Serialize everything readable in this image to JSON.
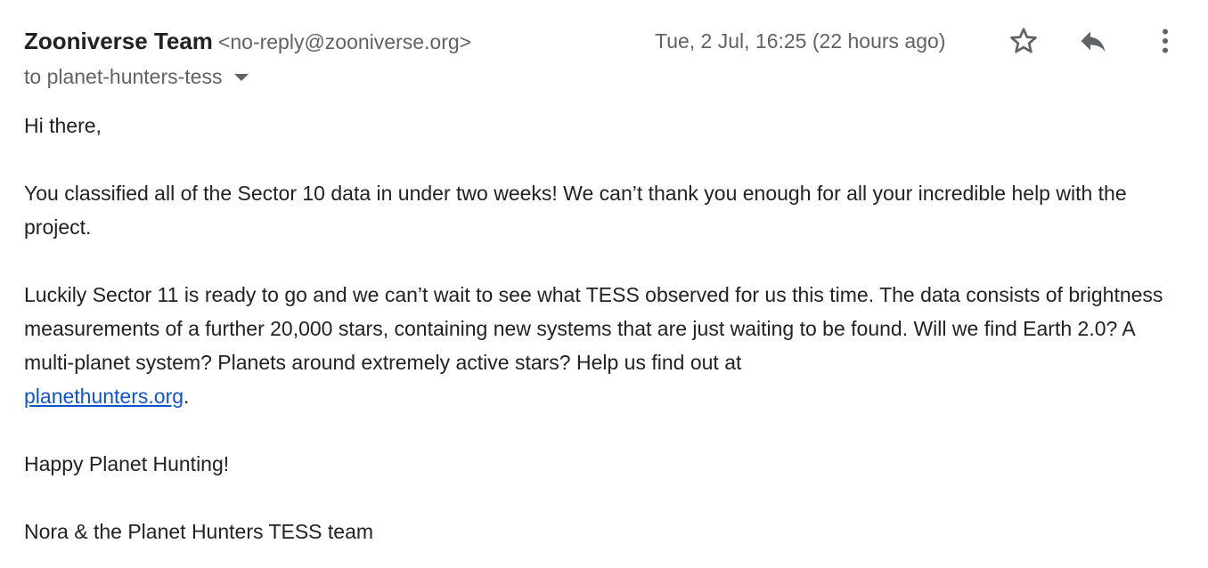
{
  "email": {
    "sender_name": "Zooniverse Team",
    "sender_email": "<no-reply@zooniverse.org>",
    "recipient": "to planet-hunters-tess",
    "timestamp": "Tue, 2 Jul, 16:25 (22 hours ago)",
    "icons": {
      "star": "star-outline-icon",
      "reply": "reply-icon",
      "more": "more-vertical-icon",
      "recipient_dropdown": "caret-down-icon"
    },
    "body": {
      "greeting": "Hi there,",
      "paragraph1": "You classified all of the Sector 10 data in under two weeks! We can’t thank you enough for all your incredible help with the project.",
      "paragraph2": "Luckily Sector 11 is ready to go and we can’t wait to see what TESS observed for us this time. The data consists of brightness measurements of a further 20,000 stars, containing new systems that are just waiting to be found. Will we find Earth 2.0? A multi-planet system? Planets around extremely active stars? Help us find out at",
      "link_text": "planethunters.org",
      "link_suffix": ".",
      "closing": "Happy Planet Hunting!",
      "signature": "Nora & the Planet Hunters TESS team"
    },
    "colors": {
      "text": "#222222",
      "muted": "#5f6368",
      "link": "#1155cc"
    }
  }
}
